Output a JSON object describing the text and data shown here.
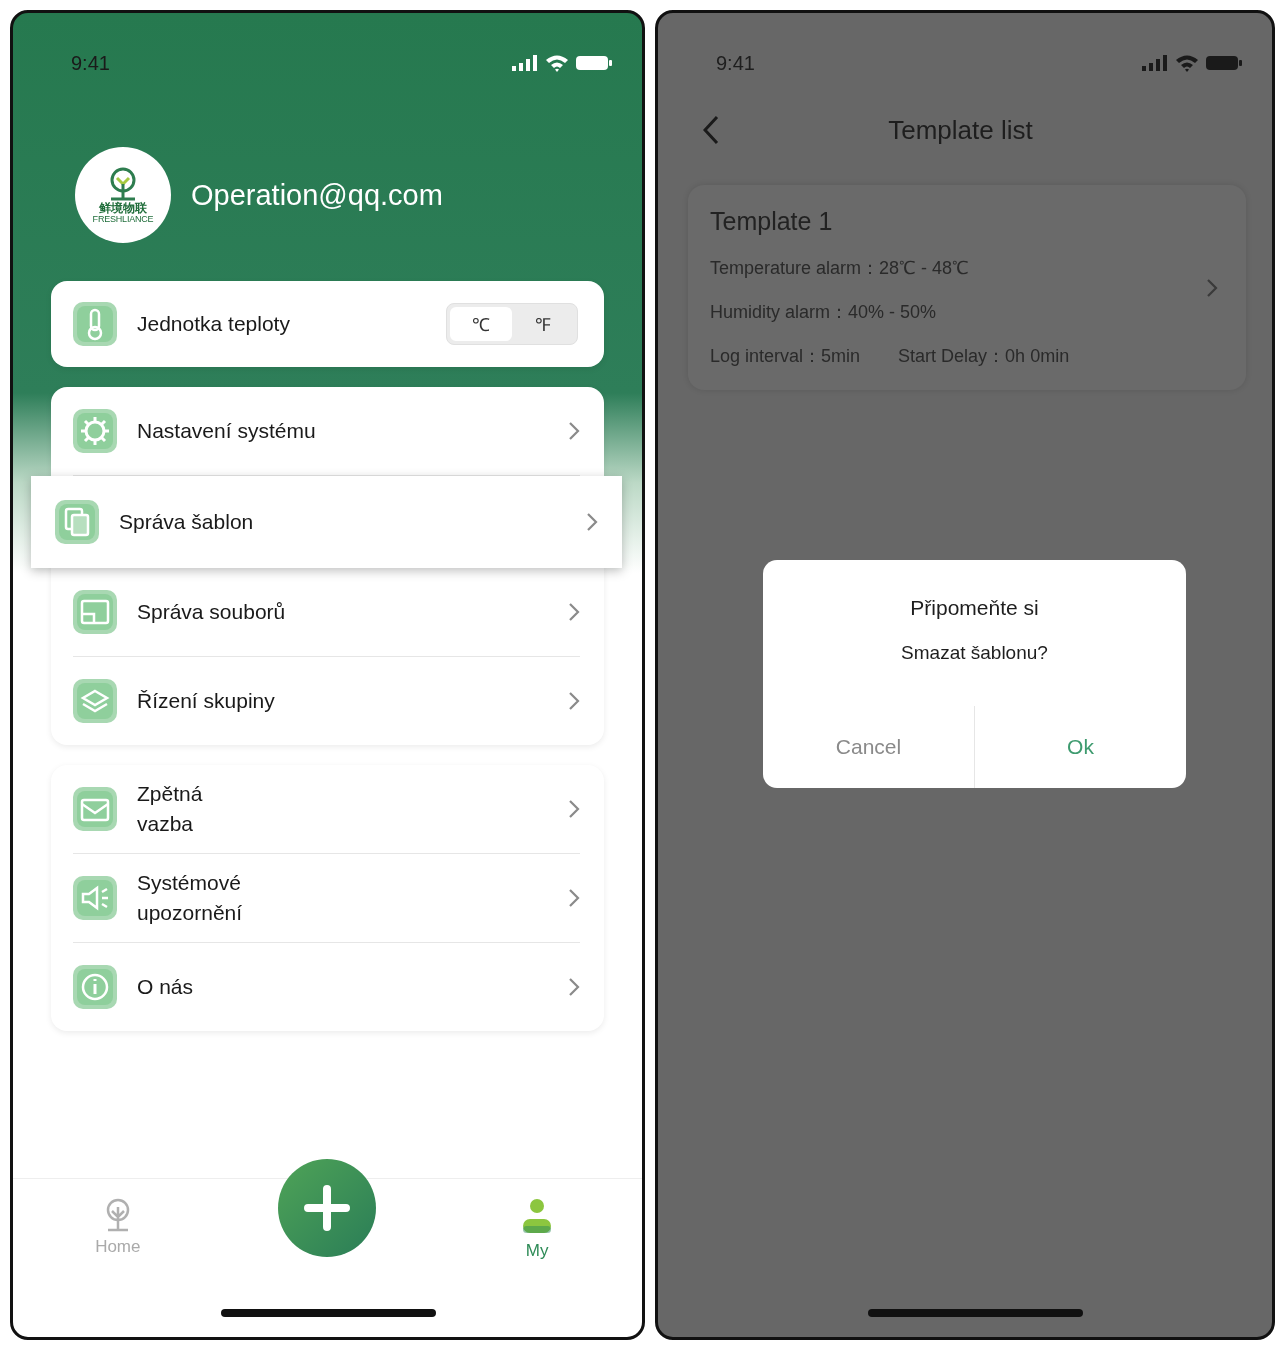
{
  "my_screen": {
    "status_bar": {
      "time": "9:41"
    },
    "profile": {
      "logo_name": "鲜境物联",
      "logo_sub": "FRESHLIANCE",
      "email": "Operation@qq.com"
    },
    "unit_card": {
      "label": "Jednotka teploty",
      "options": [
        {
          "label": "℃",
          "selected": true
        },
        {
          "label": "℉",
          "selected": false
        }
      ]
    },
    "menu_groups": [
      {
        "items": [
          {
            "label": "Nastavení systému",
            "kind": "gear",
            "highlighted": false,
            "wrapped": false
          },
          {
            "label": "Správa šablon",
            "kind": "copy",
            "highlighted": true,
            "wrapped": false
          },
          {
            "label": "Správa souborů",
            "kind": "folder",
            "highlighted": false,
            "wrapped": false
          },
          {
            "label": "Řízení skupiny",
            "kind": "layers",
            "highlighted": false,
            "wrapped": false
          }
        ]
      },
      {
        "items": [
          {
            "label": "Zpětná vazba",
            "kind": "mail",
            "highlighted": false,
            "wrapped": true
          },
          {
            "label": "Systémové upozornění",
            "kind": "speaker",
            "highlighted": false,
            "wrapped": true
          },
          {
            "label": "O nás",
            "kind": "info",
            "highlighted": false,
            "wrapped": false
          }
        ]
      }
    ],
    "tab_bar": {
      "items": [
        {
          "label": "Home",
          "kind": "tree",
          "selected": false
        },
        {
          "label": "My",
          "kind": "person",
          "selected": true
        }
      ]
    }
  },
  "template_screen": {
    "status_bar": {
      "time": "9:41"
    },
    "title": "Template list",
    "templates": [
      {
        "name": "Template 1",
        "temperature": "Temperature alarm：28℃ - 48℃",
        "humidity": "Humidity alarm：40% - 50%",
        "log_interval": "Log interval：5min",
        "start_delay": "Start Delay：0h 0min"
      }
    ],
    "dialog": {
      "title": "Připomeňte si",
      "message": "Smazat šablonu?",
      "buttons": [
        {
          "label": "Cancel",
          "kind": "cancel"
        },
        {
          "label": "Ok",
          "kind": "confirm"
        }
      ]
    }
  }
}
